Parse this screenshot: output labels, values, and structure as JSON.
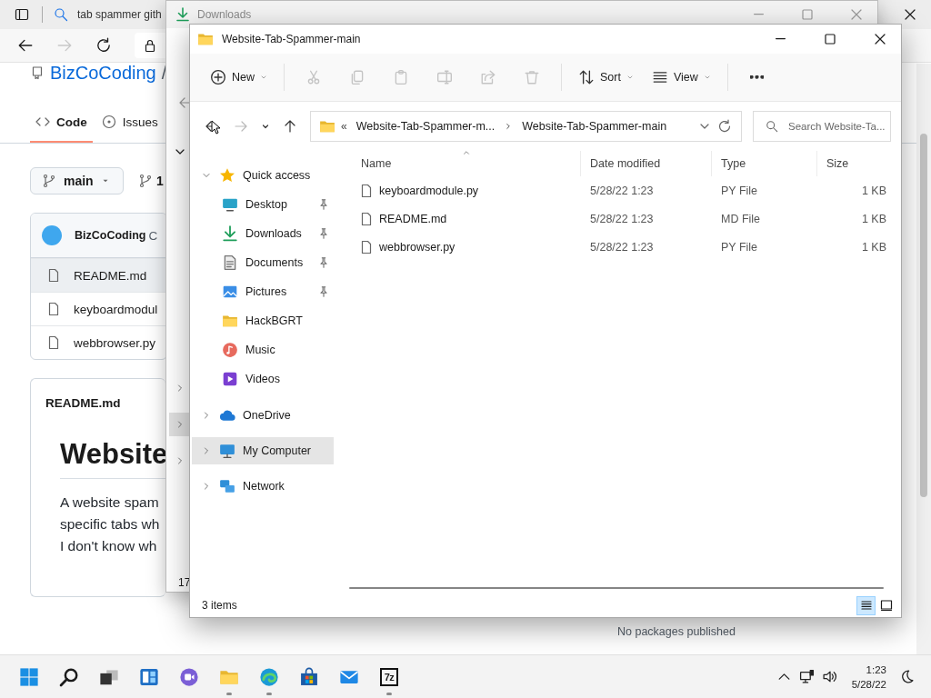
{
  "browser": {
    "tab_title": "tab spammer gith",
    "repo": {
      "owner": "BizCoCoding",
      "separator": "/"
    },
    "tabs": [
      {
        "label": "Code",
        "selected": true
      },
      {
        "label": "Issues",
        "selected": false
      }
    ],
    "branch": "main",
    "branch_count": "1",
    "commit": {
      "author": "BizCoCoding",
      "message": "C"
    },
    "files": [
      {
        "name": "README.md",
        "hovered": true
      },
      {
        "name": "keyboardmodul",
        "hovered": false
      },
      {
        "name": "webbrowser.py",
        "hovered": false
      }
    ],
    "readme": {
      "file": "README.md",
      "heading": "Website",
      "lines": [
        "A website spam",
        "specific tabs wh",
        "I don't know wh"
      ]
    },
    "sidebar_note": "No packages published"
  },
  "downloads_window": {
    "title": "Downloads",
    "status": "17",
    "nav_expanders": [
      {
        "selected": false
      },
      {
        "selected": true
      },
      {
        "selected": false
      }
    ]
  },
  "explorer": {
    "title": "Website-Tab-Spammer-main",
    "toolbar": [
      {
        "kind": "new",
        "label": "New",
        "disabled": false
      },
      {
        "kind": "cut",
        "disabled": true
      },
      {
        "kind": "copy",
        "disabled": true
      },
      {
        "kind": "paste",
        "disabled": true
      },
      {
        "kind": "rename",
        "disabled": true
      },
      {
        "kind": "share",
        "disabled": true
      },
      {
        "kind": "delete",
        "disabled": true
      },
      {
        "kind": "sort",
        "label": "Sort",
        "disabled": false
      },
      {
        "kind": "view",
        "label": "View",
        "disabled": false
      },
      {
        "kind": "more",
        "disabled": false
      }
    ],
    "nav_buttons": [
      {
        "kind": "back",
        "disabled": false
      },
      {
        "kind": "forward",
        "disabled": true
      },
      {
        "kind": "recent",
        "disabled": false
      },
      {
        "kind": "up",
        "disabled": false
      }
    ],
    "address": {
      "overflow": "«",
      "crumbs": [
        "Website-Tab-Spammer-m...",
        "Website-Tab-Spammer-main"
      ]
    },
    "search": {
      "placeholder": "Search Website-Ta..."
    },
    "nav": [
      {
        "label": "Quick access",
        "kind": "star",
        "expanded": true,
        "selected": false,
        "children": [
          {
            "label": "Desktop",
            "kind": "desktop",
            "pinned": true,
            "selected": false
          },
          {
            "label": "Downloads",
            "kind": "downloads",
            "pinned": true,
            "selected": false
          },
          {
            "label": "Documents",
            "kind": "documents",
            "pinned": true,
            "selected": false
          },
          {
            "label": "Pictures",
            "kind": "pictures",
            "pinned": true,
            "selected": false
          },
          {
            "label": "HackBGRT",
            "kind": "folder",
            "pinned": false,
            "selected": false
          },
          {
            "label": "Music",
            "kind": "music",
            "pinned": false,
            "selected": false
          },
          {
            "label": "Videos",
            "kind": "videos",
            "pinned": false,
            "selected": false
          }
        ]
      },
      {
        "label": "OneDrive",
        "kind": "cloud",
        "expanded": false,
        "selected": false
      },
      {
        "label": "My Computer",
        "kind": "computer",
        "expanded": false,
        "selected": true
      },
      {
        "label": "Network",
        "kind": "network",
        "expanded": false,
        "selected": false
      }
    ],
    "columns": [
      {
        "label": "Name",
        "sorted": true
      },
      {
        "label": "Date modified",
        "sorted": false
      },
      {
        "label": "Type",
        "sorted": false
      },
      {
        "label": "Size",
        "sorted": false
      }
    ],
    "files": [
      {
        "name": "keyboardmodule.py",
        "modified": "5/28/22 1:23",
        "type": "PY File",
        "size": "1 KB"
      },
      {
        "name": "README.md",
        "modified": "5/28/22 1:23",
        "type": "MD File",
        "size": "1 KB"
      },
      {
        "name": "webbrowser.py",
        "modified": "5/28/22 1:23",
        "type": "PY File",
        "size": "1 KB"
      }
    ],
    "status": "3 items",
    "views": [
      {
        "kind": "details",
        "selected": true
      },
      {
        "kind": "tiles",
        "selected": false
      }
    ]
  },
  "taskbar": {
    "apps": [
      {
        "kind": "start",
        "running": false
      },
      {
        "kind": "search",
        "running": false
      },
      {
        "kind": "taskview",
        "running": false
      },
      {
        "kind": "widgets",
        "running": false
      },
      {
        "kind": "chat",
        "running": false
      },
      {
        "kind": "explorer",
        "running": true
      },
      {
        "kind": "edge",
        "running": true
      },
      {
        "kind": "store",
        "running": false
      },
      {
        "kind": "mail",
        "running": false
      },
      {
        "kind": "archive",
        "label": "7z",
        "running": true
      }
    ],
    "time": "1:23",
    "date": "5/28/22"
  }
}
